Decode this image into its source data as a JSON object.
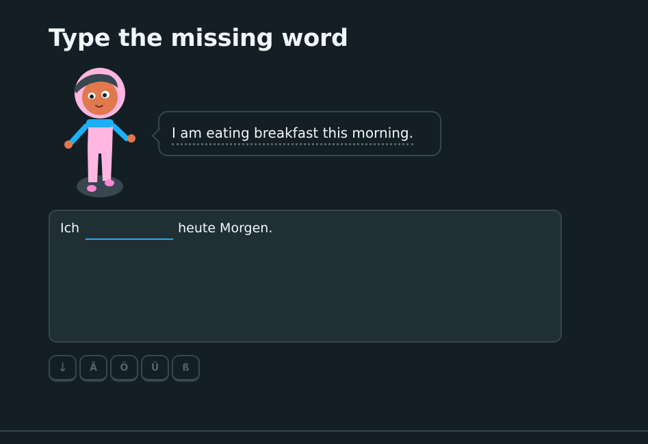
{
  "header": {
    "title": "Type the missing word"
  },
  "speech_bubble": {
    "text": "I am eating breakfast this morning."
  },
  "answer": {
    "before_text": "Ich",
    "input_value": "",
    "after_text": "heute Morgen."
  },
  "special_keys": {
    "arrow_icon": "↓",
    "a_umlaut": "Ä",
    "o_umlaut": "Ö",
    "u_umlaut": "Ü",
    "eszett": "ß"
  },
  "colors": {
    "background": "#131f24",
    "panel": "#202f36",
    "border": "#37464f",
    "accent_blue": "#1cb0f6",
    "text": "#f1f7fb"
  }
}
